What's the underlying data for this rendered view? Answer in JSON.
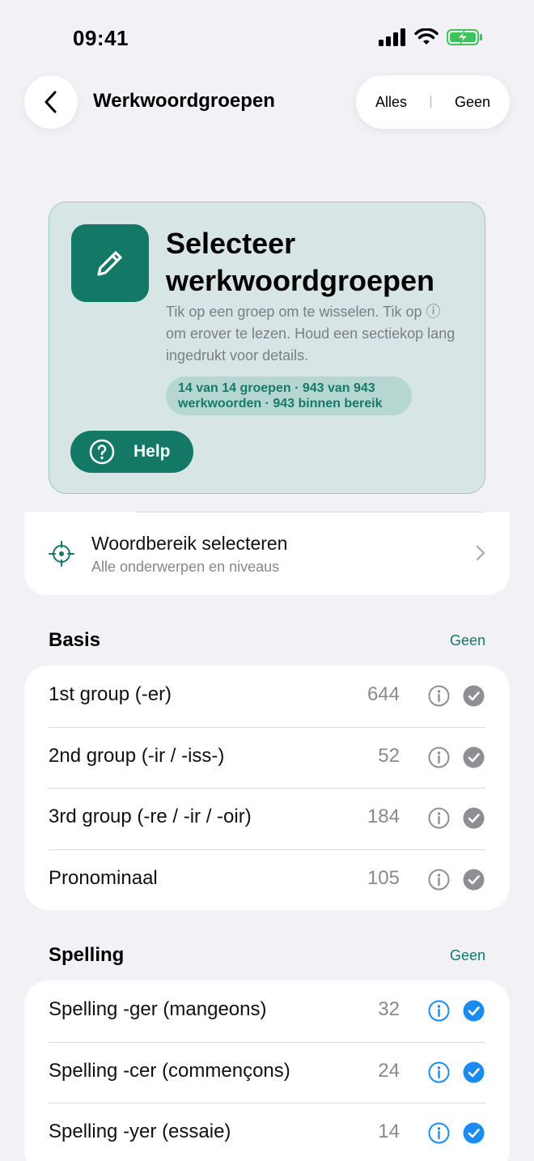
{
  "status": {
    "time": "09:41"
  },
  "nav": {
    "title": "Werkwoordgroepen",
    "all_label": "Alles",
    "none_label": "Geen"
  },
  "hero": {
    "title": "Selecteer werkwoordgroepen",
    "description": "Tik op een groep om te wisselen. Tik op ⓘ om erover te lezen. Houd een sectiekop lang ingedrukt voor details.",
    "badge": "14 van 14 groepen · 943 van 943 werkwoorden · 943 binnen bereik",
    "help_label": "Help"
  },
  "range": {
    "title": "Woordbereik selecteren",
    "subtitle": "Alle onderwerpen en niveaus"
  },
  "sections": [
    {
      "title": "Basis",
      "action": "Geen",
      "rows": [
        {
          "label": "1st group (-er)",
          "count": "644",
          "selected": false
        },
        {
          "label": "2nd group (-ir / -iss-)",
          "count": "52",
          "selected": false
        },
        {
          "label": "3rd group (-re / -ir / -oir)",
          "count": "184",
          "selected": false
        },
        {
          "label": "Pronominaal",
          "count": "105",
          "selected": false
        }
      ]
    },
    {
      "title": "Spelling",
      "action": "Geen",
      "rows": [
        {
          "label": "Spelling -ger (mangeons)",
          "count": "32",
          "selected": true
        },
        {
          "label": "Spelling -cer (commençons)",
          "count": "24",
          "selected": true
        },
        {
          "label": "Spelling -yer (essaie)",
          "count": "14",
          "selected": true
        }
      ]
    }
  ],
  "colors": {
    "accent": "#137866",
    "selected": "#1a8cf0",
    "unselected": "#8e8e93",
    "background": "#f2f2f6"
  }
}
